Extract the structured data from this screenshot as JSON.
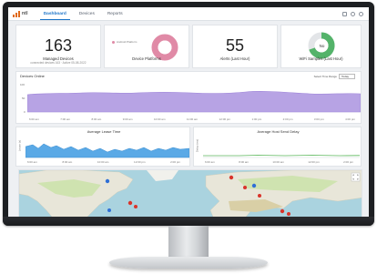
{
  "nav": {
    "logo_text": "ntl",
    "tabs": [
      {
        "label": "Dashboard",
        "active": true
      },
      {
        "label": "Devices",
        "active": false
      },
      {
        "label": "Reports",
        "active": false
      }
    ],
    "icons": [
      "grid-icon",
      "bell-icon",
      "user-icon"
    ]
  },
  "cards": {
    "managed_devices": {
      "value": "163",
      "label": "Managed Devices",
      "sub": "connected devices 163 · Active 05-08-2022"
    },
    "device_platforms": {
      "label": "Device Platforms",
      "legend": "Android Platform",
      "accent": "#e08aa6"
    },
    "alerts": {
      "value": "55",
      "label": "Alerts (Last Hour)"
    },
    "wifi": {
      "label": "WiFi Samples (Last Hour)",
      "center": "No",
      "good_color": "#54b36a",
      "bad_color": "#e3e5e8"
    }
  },
  "devices_online": {
    "title": "Devices Online",
    "select_label": "Select Time Range",
    "select_value": "Today",
    "y_ticks": [
      "100",
      "50",
      "0"
    ],
    "x_ticks": [
      "6:00 am",
      "7:00 am",
      "8:00 am",
      "9:00 am",
      "10:00 am",
      "11:00 am",
      "12:00 pm",
      "1:00 pm",
      "2:00 pm",
      "3:00 pm",
      "4:00 pm"
    ],
    "color": "#b7a3e4"
  },
  "avg_lease": {
    "title": "Average Lease Time",
    "ylabel": "Lease (s)",
    "x_ticks": [
      "6:00 am",
      "8:00 am",
      "10:00 am",
      "12:00 pm",
      "2:00 pm"
    ],
    "color": "#5aa9e6"
  },
  "avg_send": {
    "title": "Average Host Send Delay",
    "ylabel": "Delay (ms)",
    "x_ticks": [
      "6:00 am",
      "8:00 am",
      "10:00 am",
      "12:00 pm",
      "2:00 pm"
    ],
    "color": "#5cb85c"
  },
  "map": {
    "pins": [
      "blue",
      "red",
      "red",
      "blue",
      "red",
      "blue",
      "red",
      "red",
      "red",
      "red",
      "red",
      "blue"
    ]
  }
}
